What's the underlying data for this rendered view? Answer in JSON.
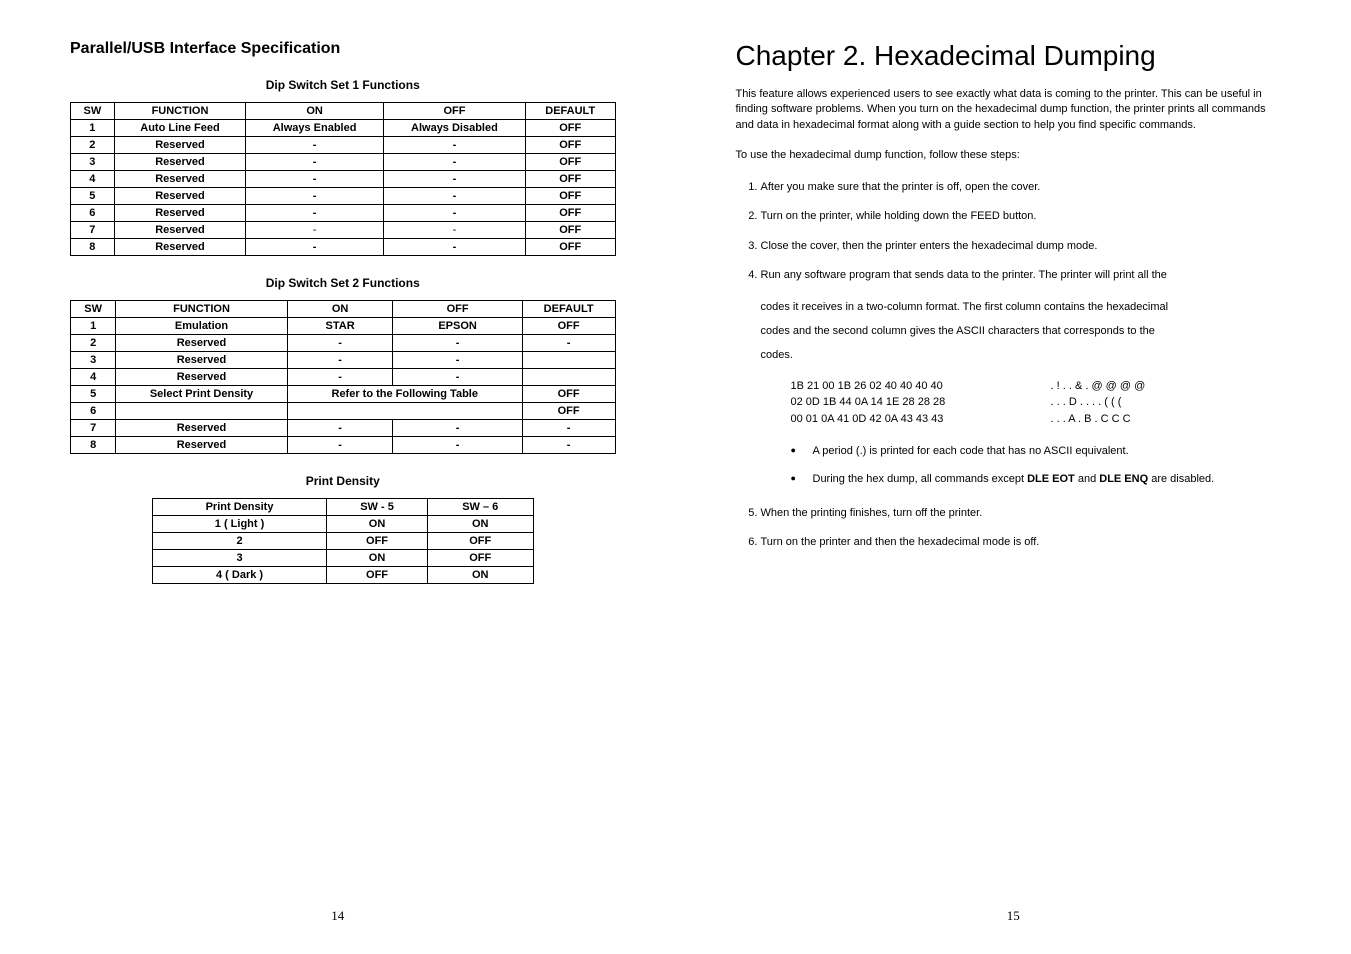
{
  "left": {
    "section_title": "Parallel/USB Interface Specification",
    "table1_title": "Dip Switch Set 1 Functions",
    "table1": {
      "headers": [
        "SW",
        "FUNCTION",
        "ON",
        "OFF",
        "DEFAULT"
      ],
      "rows": [
        {
          "sw": "1",
          "fn": "Auto Line Feed",
          "on": "Always Enabled",
          "off": "Always Disabled",
          "def": "OFF"
        },
        {
          "sw": "2",
          "fn": "Reserved",
          "on": "-",
          "off": "-",
          "def": "OFF"
        },
        {
          "sw": "3",
          "fn": "Reserved",
          "on": "-",
          "off": "-",
          "def": "OFF"
        },
        {
          "sw": "4",
          "fn": "Reserved",
          "on": "-",
          "off": "-",
          "def": "OFF"
        },
        {
          "sw": "5",
          "fn": "Reserved",
          "on": "-",
          "off": "-",
          "def": "OFF"
        },
        {
          "sw": "6",
          "fn": "Reserved",
          "on": "-",
          "off": "-",
          "def": "OFF"
        },
        {
          "sw": "7",
          "fn": "Reserved",
          "on": "-",
          "off": "-",
          "def": "OFF"
        },
        {
          "sw": "8",
          "fn": "Reserved",
          "on": "-",
          "off": "-",
          "def": "OFF"
        }
      ]
    },
    "table2_title": "Dip Switch Set 2 Functions",
    "table2": {
      "headers": [
        "SW",
        "FUNCTION",
        "ON",
        "OFF",
        "DEFAULT"
      ],
      "rows": [
        {
          "sw": "1",
          "fn": "Emulation",
          "on": "STAR",
          "off": "EPSON",
          "def": "OFF"
        },
        {
          "sw": "2",
          "fn": "Reserved",
          "on": "-",
          "off": "-",
          "def": "-"
        },
        {
          "sw": "3",
          "fn": "Reserved",
          "on": "-",
          "off": "-",
          "def": ""
        },
        {
          "sw": "4",
          "fn": "Reserved",
          "on": "-",
          "off": "-",
          "def": ""
        },
        {
          "sw": "5",
          "fn": "Select Print Density",
          "refer": "Refer to the Following Table",
          "def": "OFF"
        },
        {
          "sw": "6",
          "fn": "",
          "on": "",
          "off": "",
          "def": "OFF"
        },
        {
          "sw": "7",
          "fn": "Reserved",
          "on": "-",
          "off": "-",
          "def": "-"
        },
        {
          "sw": "8",
          "fn": "Reserved",
          "on": "-",
          "off": "-",
          "def": "-"
        }
      ]
    },
    "table3_title": "Print Density",
    "table3": {
      "headers": [
        "Print Density",
        "SW - 5",
        "SW – 6"
      ],
      "rows": [
        {
          "pd": "1 ( Light )",
          "s5": "ON",
          "s6": "ON"
        },
        {
          "pd": "2",
          "s5": "OFF",
          "s6": "OFF"
        },
        {
          "pd": "3",
          "s5": "ON",
          "s6": "OFF"
        },
        {
          "pd": "4 ( Dark )",
          "s5": "OFF",
          "s6": "ON"
        }
      ]
    },
    "page_num": "14"
  },
  "right": {
    "chapter_title": "Chapter 2. Hexadecimal Dumping",
    "intro": "This feature allows experienced users to see exactly what data is coming to the printer. This can be useful in finding software problems. When you turn on the hexadecimal dump function, the printer prints all commands and data in hexadecimal format along with a guide section to help you find specific commands.",
    "use_line": "To use the hexadecimal dump function, follow these steps:",
    "steps": [
      "After you make sure that the printer is off, open the cover.",
      "Turn on the printer, while holding down the FEED button.",
      "Close the cover, then the printer enters the hexadecimal dump mode.",
      "Run any software program that sends data to the printer. The printer will print all the"
    ],
    "step4_sub1": "codes it receives in a two-column format. The first column contains the hexadecimal",
    "step4_sub2": "codes and the second column gives the ASCII characters that corresponds to the",
    "step4_sub3": "codes.",
    "hex": [
      {
        "b": "1B 21 00 1B 26 02 40 40 40 40",
        "a": ". ! . . & . @ @ @ @"
      },
      {
        "b": "02 0D 1B 44 0A 14 1E 28 28 28",
        "a": ". . . D . . . . ( ( ("
      },
      {
        "b": "00 01 0A 41 0D 42 0A 43 43 43",
        "a": ". . . A . B . C C C"
      }
    ],
    "bullets": [
      "A period (.) is printed for each code that has no ASCII equivalent.",
      "During the hex dump, all commands except DLE EOT and DLE ENQ are disabled."
    ],
    "step5": "When the printing finishes, turn off the printer.",
    "step6": "Turn on the printer and then the hexadecimal mode is off.",
    "page_num": "15"
  }
}
